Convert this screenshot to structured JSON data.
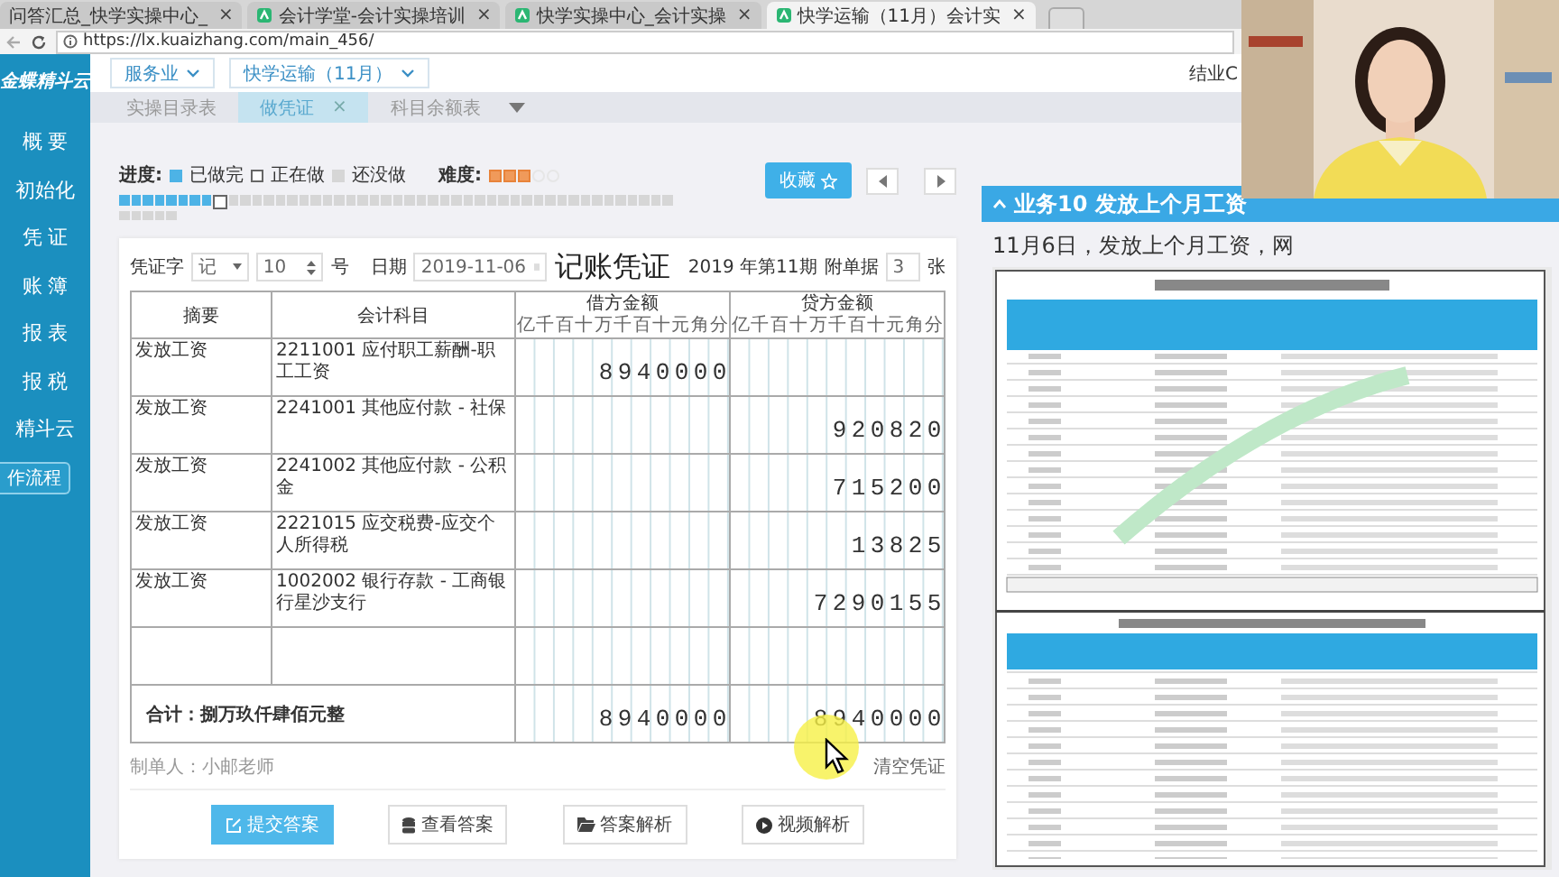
{
  "browser": {
    "tabs": [
      {
        "label": "问答汇总_快学实操中心_",
        "favicon": false,
        "selected": false,
        "close": "×"
      },
      {
        "label": "会计学堂-会计实操培训",
        "favicon": true,
        "selected": false,
        "close": "×"
      },
      {
        "label": "快学实操中心_会计实操",
        "favicon": true,
        "selected": false,
        "close": "×"
      },
      {
        "label": "快学运输（11月）会计实",
        "favicon": true,
        "selected": true,
        "close": "×"
      }
    ],
    "address": "https://lx.kuaizhang.com/main_456/"
  },
  "sidebar": {
    "logo": "金蝶精斗云",
    "items": [
      "概 要",
      "初始化",
      "凭 证",
      "账 簿",
      "报 表",
      "报 税",
      "精斗云"
    ],
    "button": "作流程"
  },
  "top_bar": {
    "selectors": [
      "服务业",
      "快学运输（11月）"
    ],
    "user": "结业C"
  },
  "page_tabs": [
    {
      "label": "实操目录表",
      "selected": false,
      "closable": false
    },
    {
      "label": "做凭证",
      "selected": true,
      "closable": true,
      "close": "×"
    },
    {
      "label": "科目余额表",
      "selected": false,
      "closable": false
    }
  ],
  "progress": {
    "label": "进度:",
    "legend": [
      {
        "label": "已做完",
        "kind": "done"
      },
      {
        "label": "正在做",
        "kind": "current"
      },
      {
        "label": "还没做",
        "kind": "todo"
      }
    ],
    "difficulty_label": "难度:",
    "stars": 3,
    "tasks": [
      {
        "kind": "done"
      },
      {
        "kind": "done"
      },
      {
        "kind": "done"
      },
      {
        "kind": "done"
      },
      {
        "kind": "done"
      },
      {
        "kind": "done"
      },
      {
        "kind": "done"
      },
      {
        "kind": "done"
      },
      {
        "kind": "current"
      },
      {
        "kind": "todo"
      },
      {
        "kind": "todo"
      },
      {
        "kind": "todo"
      },
      {
        "kind": "todo"
      },
      {
        "kind": "todo"
      },
      {
        "kind": "todo"
      },
      {
        "kind": "todo"
      },
      {
        "kind": "todo"
      },
      {
        "kind": "todo"
      },
      {
        "kind": "todo"
      },
      {
        "kind": "todo"
      },
      {
        "kind": "todo"
      },
      {
        "kind": "todo"
      },
      {
        "kind": "todo"
      },
      {
        "kind": "todo"
      },
      {
        "kind": "todo"
      },
      {
        "kind": "todo"
      },
      {
        "kind": "todo"
      },
      {
        "kind": "todo"
      },
      {
        "kind": "todo"
      },
      {
        "kind": "todo"
      },
      {
        "kind": "todo"
      },
      {
        "kind": "todo"
      },
      {
        "kind": "todo"
      },
      {
        "kind": "todo"
      },
      {
        "kind": "todo"
      },
      {
        "kind": "todo"
      },
      {
        "kind": "todo"
      },
      {
        "kind": "todo"
      },
      {
        "kind": "todo"
      },
      {
        "kind": "todo"
      },
      {
        "kind": "todo"
      },
      {
        "kind": "todo"
      },
      {
        "kind": "todo"
      },
      {
        "kind": "todo"
      },
      {
        "kind": "todo"
      },
      {
        "kind": "todo"
      },
      {
        "kind": "todo"
      },
      {
        "kind": "todo"
      },
      {
        "kind": "todo"
      },
      {
        "kind": "todo"
      },
      {
        "kind": "todo"
      },
      {
        "kind": "todo"
      }
    ],
    "favorite_button": "收藏"
  },
  "voucher": {
    "type_label": "凭证字",
    "type": "记",
    "number": "10",
    "number_suffix": "号",
    "date_label": "日期",
    "date": "2019-11-06",
    "title": "记账凭证",
    "period": "2019 年第11期",
    "attachments_label": "附单据",
    "attachments": "3",
    "attachments_suffix": "张",
    "columns": [
      {
        "label": "摘要"
      },
      {
        "label": "会计科目"
      },
      {
        "label": "借方金额",
        "units": [
          "亿",
          "千",
          "百",
          "十",
          "万",
          "千",
          "百",
          "十",
          "元",
          "角",
          "分"
        ]
      },
      {
        "label": "贷方金额",
        "units": [
          "亿",
          "千",
          "百",
          "十",
          "万",
          "千",
          "百",
          "十",
          "元",
          "角",
          "分"
        ]
      }
    ],
    "rows": [
      {
        "kind": "entry",
        "summary": "发放工资",
        "account": "2211001 应付职工薪酬-职工工资",
        "debit": "8940000"
      },
      {
        "kind": "entry",
        "summary": "发放工资",
        "account": "2241001 其他应付款 - 社保",
        "credit": "920820"
      },
      {
        "kind": "entry",
        "summary": "发放工资",
        "account": "2241002 其他应付款 - 公积金",
        "credit": "715200"
      },
      {
        "kind": "entry",
        "summary": "发放工资",
        "account": "2221015 应交税费-应交个人所得税",
        "credit": "13825"
      },
      {
        "kind": "entry",
        "summary": "发放工资",
        "account": "1002002 银行存款 - 工商银行星沙支行",
        "credit": "7290155"
      },
      {
        "kind": "blank"
      }
    ],
    "total_label": "合计：捌万玖仟肆佰元整",
    "total_debit": "8940000",
    "total_credit": "8940000",
    "preparer": "制单人：小邮老师",
    "clear": "清空凭证"
  },
  "actions": [
    {
      "label": "提交答案",
      "primary": true
    },
    {
      "label": "查看答案",
      "primary": false
    },
    {
      "label": "答案解析",
      "primary": false
    },
    {
      "label": "视频解析",
      "primary": false
    }
  ],
  "task_panel": {
    "title": "业务10 发放上个月工资",
    "text": "11月6日，发放上个月工资，网"
  }
}
